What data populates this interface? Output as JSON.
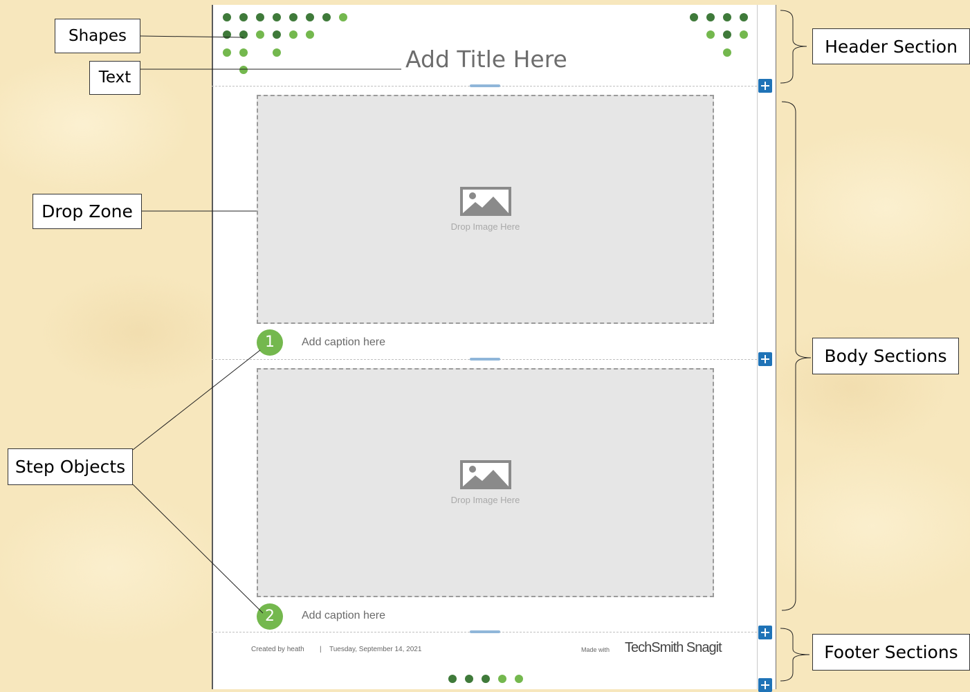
{
  "callouts": {
    "shapes": "Shapes",
    "text": "Text",
    "drop_zone": "Drop Zone",
    "step_objects": "Step Objects",
    "header_section": "Header Section",
    "body_sections": "Body Sections",
    "footer_sections": "Footer Sections"
  },
  "template": {
    "title": "Add Title Here",
    "drop_zone_label": "Drop Image Here",
    "steps": [
      {
        "number": "1",
        "caption": "Add caption here"
      },
      {
        "number": "2",
        "caption": "Add caption here"
      }
    ],
    "footer": {
      "created_by": "Created by heath",
      "separator": "|",
      "date": "Tuesday, September 14, 2021",
      "made_with": "Made with",
      "brand": "TechSmith Snagit"
    }
  },
  "colors": {
    "dot_dark": "#3f7a3a",
    "dot_light": "#74b84e",
    "step_badge": "#74b84e",
    "add_button": "#1f73b7",
    "handle": "#8fb6d9",
    "background": "#f7e7bd"
  }
}
